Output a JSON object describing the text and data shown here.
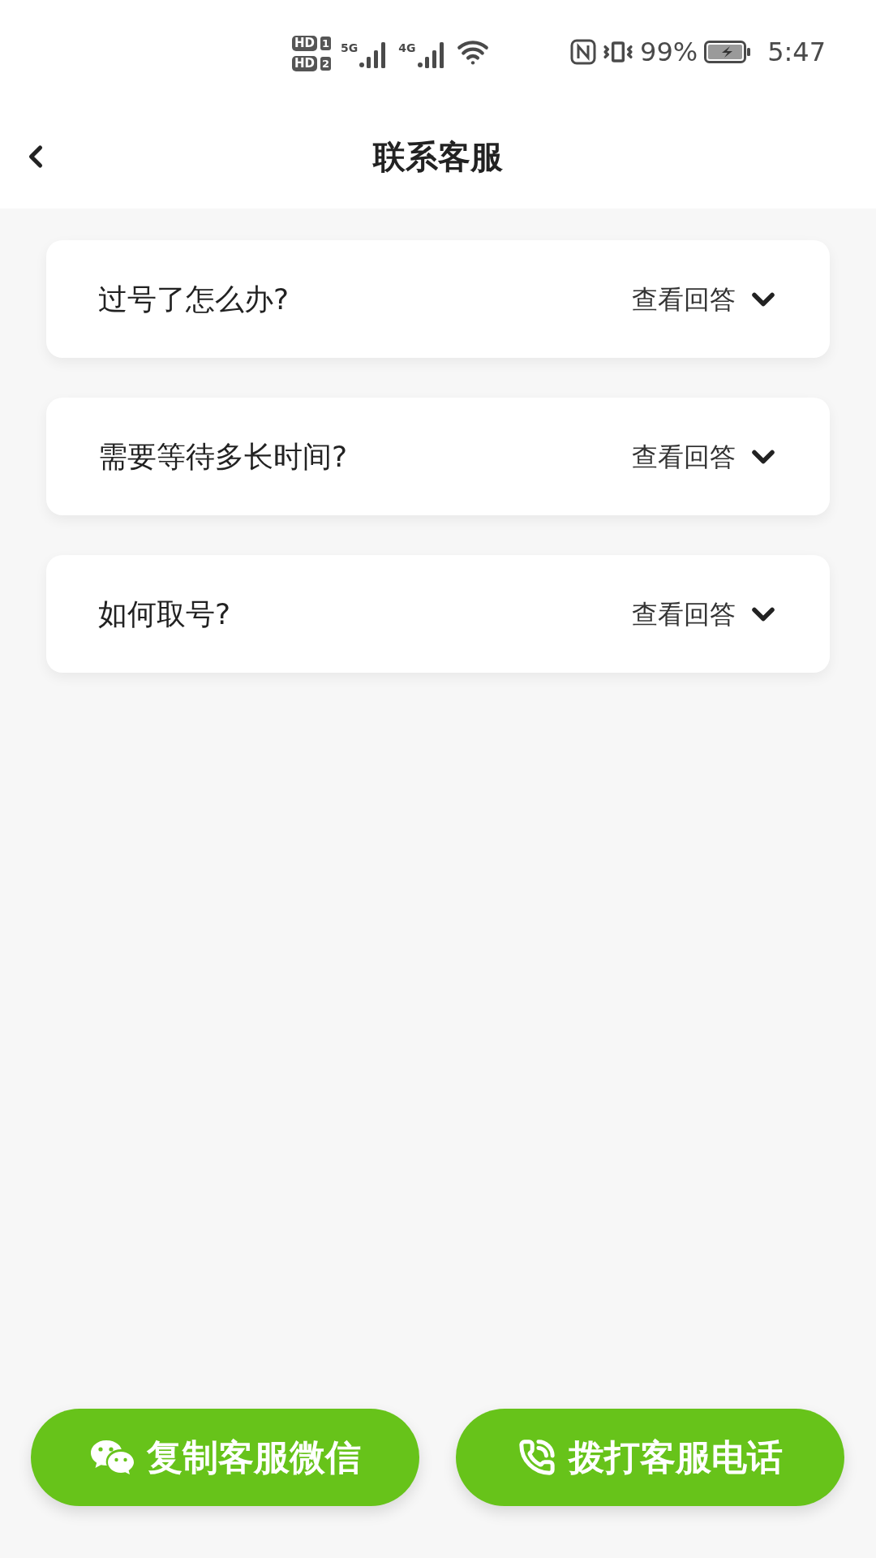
{
  "status_bar": {
    "hd_badges": [
      {
        "label": "HD",
        "slot": "1"
      },
      {
        "label": "HD",
        "slot": "2"
      }
    ],
    "networks": [
      "5G",
      "4G"
    ],
    "battery": "99%",
    "time": "5:47"
  },
  "header": {
    "title": "联系客服"
  },
  "faq": [
    {
      "question": "过号了怎么办?",
      "action": "查看回答",
      "expanded": false
    },
    {
      "question": "需要等待多长时间?",
      "action": "查看回答",
      "expanded": false
    },
    {
      "question": "如何取号?",
      "action": "查看回答",
      "expanded": false
    }
  ],
  "buttons": [
    {
      "label": "复制客服微信",
      "kind": "wechat"
    },
    {
      "label": "拨打客服电话",
      "kind": "phone"
    }
  ]
}
